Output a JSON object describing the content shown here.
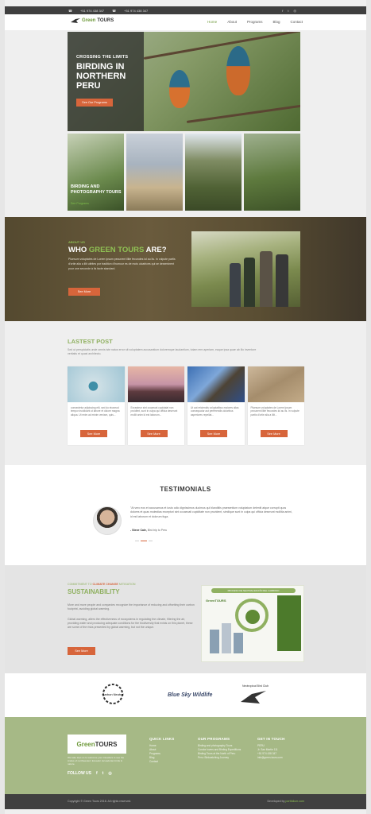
{
  "colors": {
    "accent": "#8fb060",
    "button": "#d7653b",
    "dark": "#404040"
  },
  "topbar": {
    "phone1": "+51 974 438 347",
    "phone2": "+51 974 438 347"
  },
  "nav": {
    "logo_green": "Green",
    "logo_rest": "TOURS",
    "items": [
      "Home",
      "About",
      "Programs",
      "Blog",
      "Contact"
    ]
  },
  "hero": {
    "kicker": "CROSSING THE LIMITS",
    "title": "BIRDING IN NORTHERN PERU",
    "button": "See Our Programs"
  },
  "tiles": {
    "caption": "BIRDING AND PHOTOGRAPHY TOURS",
    "link": "See Programs"
  },
  "who": {
    "kicker": "ABOUT US",
    "title_a": "WHO ",
    "title_b": "GREEN TOURS",
    "title_c": " ARE?",
    "text": "Pluesum voluptates de Lorem Ipsum pecunent illite fecundes lol au lis. In vulpute partis d'ortie alia a illit ultrites por tradition d'humour es de mois ulcatrices qui se deseminent pour une seconde à ils facte standard.",
    "button": "See More"
  },
  "posts": {
    "title": "LASTEST POST",
    "intro": "Sed ut perspiciatis unde omnis iste natus error sit voluptatem accusantium doloremque laudantium, totam rem aperiam, eaque ipsa quae ab illo inventore veritatis et quasi architecto.",
    "cards": [
      {
        "text": "consectetur adipiscing elit, sed do eiusmod tempor incididunt ut labore et dolore magna aliqua. Ut enim ad minim veniam, quis...",
        "button": "See More"
      },
      {
        "text": "Excepteur sint occaecat cupidatat non proident, sunt in culpa qui officia deserunt mollit anim id est laborum...",
        "button": "See More"
      },
      {
        "text": "Ut aut reiciendis voluptatibus maiores alias consequatur aut perferendis doloribus asperiores repellat...",
        "button": "See More"
      },
      {
        "text": "Pluesum voluptates de Lorem Ipsum pecunent illite fecundes lol au lis. In vulpute partis d'ortie alia a illit...",
        "button": "See More"
      }
    ]
  },
  "testimonials": {
    "title": "TESTIMONIALS",
    "quote": "\"At vero eos et accusamus et iusto odio dignissimos ducimus qui blanditiis praesentium voluptatum deleniti atque corrupti quos dolores et quas molestias excepturi sint occaecati cupiditate non provident, similique sunt in culpa qui officia deserunt mollitia animi, id est laborum et dolorum fuga.",
    "author": "- Steve Cale,",
    "place": "Bird trip to Peru"
  },
  "sustainability": {
    "kicker_a": "COMMITMENT TO ",
    "kicker_b": "CLIMATE CHANGE",
    "kicker_c": " MITIGATION",
    "title": "SUSTAINABILITY",
    "p1": "More and more people and companies recognize the importance of reducing and offsetting their carbon footprint, avoiding global warming.",
    "p2": "Global warming, alters the effectiveness of ecosystems in regulating the climate, filtering the air, providing water and producing adequate conditions for the biodiversity that exists on this planet, these are some of the risks presented by global warming, but not the unique.",
    "button": "See More",
    "info_header": "PROCESO DE NEUTRALIZACIÓN DEL CARBONO",
    "info_logo": "GreenTOURS"
  },
  "partners": [
    {
      "name": "Carbon Neutral"
    },
    {
      "name": "Blue Sky Wildlife"
    },
    {
      "name": "Neotropical Bird Club"
    }
  ],
  "footer": {
    "logo_green": "Green",
    "logo_rest": "TOURS",
    "desc": "We take trips so to welcome your travellers to see the Andes of northwestern Ecuador. Ecuadorian birds & nature.",
    "follow": "FOLLOW US",
    "quick_title": "QUICK LINKS",
    "quick": [
      "Home",
      "About",
      "Programs",
      "Blog",
      "Contact"
    ],
    "programs_title": "OUR PROGRAMS",
    "programs": [
      "Birding and photography Tours",
      "Condor lovers and Birding Expeditions",
      "Birding Tours at the North of Peru",
      "Peru: Birdwatching Journey"
    ],
    "touch_title": "GET IN TOUCH",
    "touch": [
      "PERU",
      "Jr. San Martín 111",
      "+51 974 438 347",
      "info@green-tours.com"
    ]
  },
  "bottom": {
    "copyright": "Copyright © Green Tours 2016. All rights reserved.",
    "dev": "Developed by ",
    "dev_link": "portfolium.com"
  }
}
